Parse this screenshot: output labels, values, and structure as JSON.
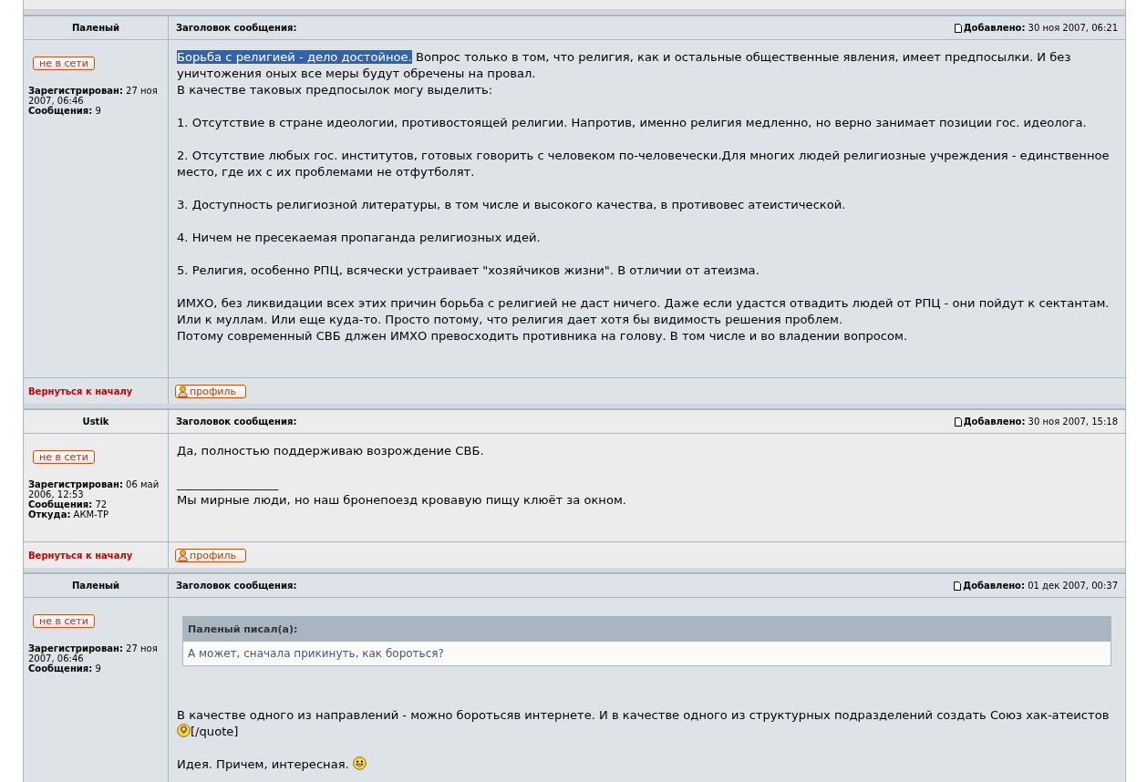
{
  "posts": [
    {
      "author": "Паленый",
      "subject_label": "Заголовок сообщения:",
      "posted_label": "Добавлено:",
      "posted": "30 ноя 2007, 06:21",
      "status": "не в сети",
      "details": [
        {
          "label": "Зарегистрирован:",
          "value": "27 ноя 2007, 06:46"
        },
        {
          "label": "Сообщения:",
          "value": "9"
        }
      ],
      "body": [
        {
          "kind": "text",
          "selected_part": "Борьба с религией - дело достойное.",
          "lines": [
            " Вопрос только в том, что религия, как и остальные общественные явления, имеет предпосылки. И без уничтожения оных все меры будут обречены на провал.",
            "В качестве таковых предпосылок могу выделить:"
          ]
        },
        {
          "kind": "text",
          "lines": [
            "1. Отсутствие в стране идеологии, противостоящей религии. Напротив, именно религия медленно, но верно занимает позиции гос. идеолога."
          ]
        },
        {
          "kind": "text",
          "lines": [
            "2. Отсутствие любых гос. институтов, готовых говорить с человеком по-человечески.Для многих людей религиозные учреждения - единственное место, где их с их проблемами не отфутболят."
          ]
        },
        {
          "kind": "text",
          "lines": [
            "3. Доступность религиозной литературы, в том числе и высокого качества, в противовес атеистической."
          ]
        },
        {
          "kind": "text",
          "lines": [
            "4. Ничем не пресекаемая пропаганда религиозных идей."
          ]
        },
        {
          "kind": "text",
          "lines": [
            "5. Религия, особенно РПЦ, всячески устраивает \"хозяйчиков жизни\". В отличии от атеизма."
          ]
        },
        {
          "kind": "text",
          "lines": [
            "ИМХО, без ликвидации всех этих причин борьба с религией не даст ничего. Даже если удастся отвадить людей от РПЦ - они пойдут к сектантам. Или к муллам. Или еще куда-то. Просто потому, что религия дает хотя бы видимость решения проблем.",
            "Потому современный СВБ длжен ИМХО превосходить противника на голову. В том числе и во владении вопросом."
          ]
        }
      ],
      "back_link": "Вернуться к началу",
      "profile_button": "профиль"
    },
    {
      "author": "Ustik",
      "subject_label": "Заголовок сообщения:",
      "posted_label": "Добавлено:",
      "posted": "30 ноя 2007, 15:18",
      "status": "не в сети",
      "details": [
        {
          "label": "Зарегистрирован:",
          "value": "06 май 2006, 12:53"
        },
        {
          "label": "Сообщения:",
          "value": "72"
        },
        {
          "label": "Откуда:",
          "value": "АКМ-ТР"
        }
      ],
      "body": [
        {
          "kind": "text",
          "lines": [
            "Да, полностью поддерживаю возрождение СВБ."
          ]
        },
        {
          "kind": "signature",
          "lines": [
            "_________________",
            "Мы мирные люди, но наш бронепоезд кровавую пищу клюёт за окном."
          ]
        }
      ],
      "back_link": "Вернуться к началу",
      "profile_button": "профиль"
    },
    {
      "author": "Паленый",
      "subject_label": "Заголовок сообщения:",
      "posted_label": "Добавлено:",
      "posted": "01 дек 2007, 00:37",
      "status": "не в сети",
      "details": [
        {
          "label": "Зарегистрирован:",
          "value": "27 ноя 2007, 06:46"
        },
        {
          "label": "Сообщения:",
          "value": "9"
        }
      ],
      "body": [
        {
          "kind": "quote",
          "title": "Паленый писал(а):",
          "lines": [
            "А может, сначала прикинуть, как бороться?"
          ]
        },
        {
          "kind": "rich",
          "parts": [
            {
              "kind": "text",
              "text": "В качестве одного из направлений - можно боротьсяв интернете. И в качестве одного из структурных подразделений создать Союз хак-атеистов"
            },
            {
              "kind": "bulb"
            },
            {
              "kind": "text",
              "text": "[/quote]"
            }
          ]
        },
        {
          "kind": "rich",
          "parts": [
            {
              "kind": "text",
              "text": "Идея. Причем, интересная. "
            },
            {
              "kind": "smiley"
            }
          ]
        }
      ]
    }
  ]
}
